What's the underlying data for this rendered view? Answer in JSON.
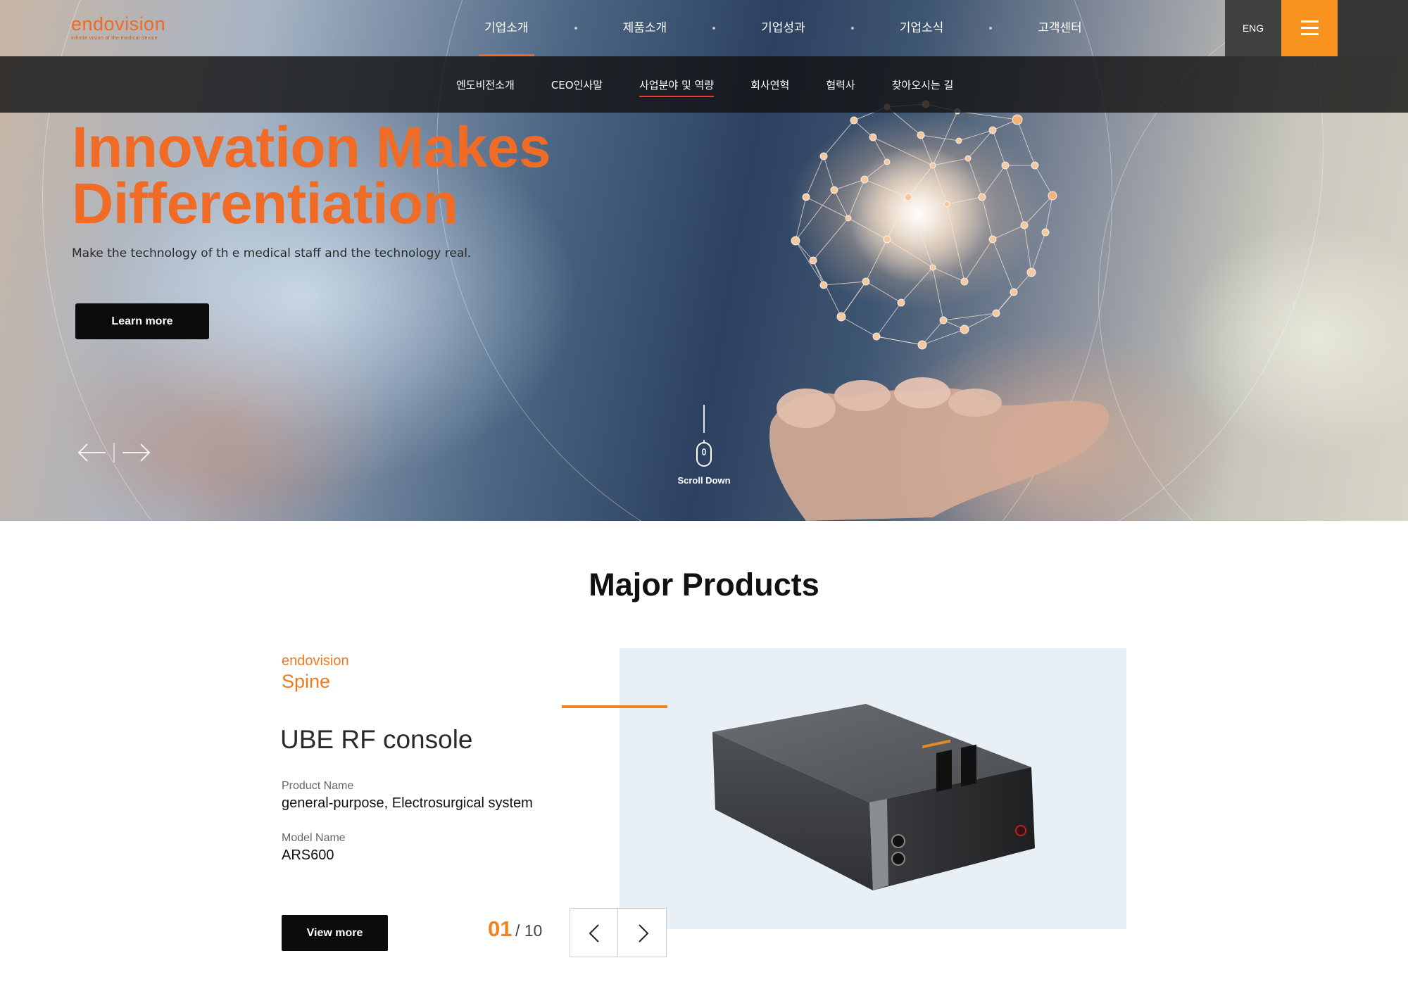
{
  "brand": {
    "logo": "endovision",
    "tagline": "infinite vision of the medical device"
  },
  "header": {
    "nav": [
      "기업소개",
      "제품소개",
      "기업성과",
      "기업소식",
      "고객센터"
    ],
    "lang_button": "ENG",
    "menu_icon": "hamburger-icon",
    "accent_color": "#f7931e"
  },
  "subnav": {
    "items": [
      "엔도비전소개",
      "CEO인사말",
      "사업분야 및 역량",
      "회사연혁",
      "협력사",
      "찾아오시는 길"
    ],
    "active_index": 2
  },
  "hero": {
    "title_line1": "Innovation Makes",
    "title_line2": "Differentiation",
    "subtitle": "Make the technology of th e medical staff and the technology real.",
    "cta": "Learn more",
    "scroll_label": "Scroll Down",
    "title_color": "#f06b26"
  },
  "products": {
    "heading_light": "Major",
    "heading_bold": "Products",
    "brand": "endovision",
    "category": "Spine",
    "title": "UBE RF console",
    "product_name_label": "Product Name",
    "product_name": "general-purpose, Electrosurgical system",
    "model_name_label": "Model Name",
    "model_name": "ARS600",
    "cta": "View more",
    "counter_current": "01",
    "counter_total": "/ 10"
  }
}
